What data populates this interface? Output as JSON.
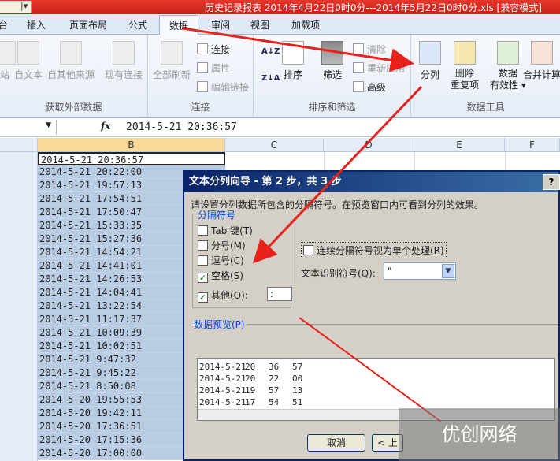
{
  "title_bar": {
    "quick_access": "|▾",
    "title": "历史记录报表 2014年4月22日0时0分---2014年5月22日0时0分.xls [兼容模式]"
  },
  "tabs": [
    "台",
    "插入",
    "页面布局",
    "公式",
    "数据",
    "审阅",
    "视图",
    "加载项"
  ],
  "active_tab": "数据",
  "ribbon": {
    "external": {
      "web": "站",
      "text": "自文本",
      "other": "自其他来源",
      "existing": "现有连接",
      "label": "获取外部数据"
    },
    "connections": {
      "refresh_all": "全部刷新",
      "connections": "连接",
      "properties": "属性",
      "edit_links": "编辑链接",
      "label": "连接"
    },
    "sort": {
      "sort": "排序",
      "filter": "筛选",
      "clear": "清除",
      "reapply": "重新应用",
      "advanced": "高级",
      "label": "排序和筛选",
      "az": "A↓Z",
      "za": "Z↓A"
    },
    "tools": {
      "text_to_columns": "分列",
      "remove_duplicates": "删除",
      "remove_duplicates_2": "重复项",
      "validation": "数据",
      "validation_2": "有效性",
      "consolidate": "合并计算",
      "label": "数据工具"
    }
  },
  "formula_bar": {
    "fx": "fx",
    "value": "2014-5-21  20:36:57"
  },
  "columns": [
    "B",
    "C",
    "D",
    "E",
    "F"
  ],
  "cells": [
    "2014-5-21 20:36:57",
    "2014-5-21 20:22:00",
    "2014-5-21 19:57:13",
    "2014-5-21 17:54:51",
    "2014-5-21 17:50:47",
    "2014-5-21 15:33:35",
    "2014-5-21 15:27:36",
    "2014-5-21 14:54:21",
    "2014-5-21 14:41:01",
    "2014-5-21 14:26:53",
    "2014-5-21 14:04:41",
    "2014-5-21 13:22:54",
    "2014-5-21 11:17:37",
    "2014-5-21 10:09:39",
    "2014-5-21 10:02:51",
    "2014-5-21 9:47:32",
    "2014-5-21 9:45:22",
    "2014-5-21 8:50:08",
    "2014-5-20 19:55:53",
    "2014-5-20 19:42:11",
    "2014-5-20 17:36:51",
    "2014-5-20 17:15:36",
    "2014-5-20 17:00:00"
  ],
  "dialog": {
    "title": "文本分列向导 - 第 2 步，共 3 步",
    "help": "?",
    "description": "请设置分列数据所包含的分隔符号。在预览窗口内可看到分列的效果。",
    "delimiters_legend": "分隔符号",
    "options": [
      {
        "label": "Tab 键(T)",
        "checked": false
      },
      {
        "label": "分号(M)",
        "checked": false
      },
      {
        "label": "逗号(C)",
        "checked": false
      },
      {
        "label": "空格(S)",
        "checked": true
      },
      {
        "label": "其他(O):",
        "checked": true
      }
    ],
    "other_value": ":",
    "consecutive": "连续分隔符号视为单个处理(R)",
    "qualifier_label": "文本识别符号(Q):",
    "qualifier_value": "\"",
    "preview_label": "数据预览(P)",
    "preview_rows": [
      [
        "2014-5-21",
        "20",
        "36",
        "57"
      ],
      [
        "2014-5-21",
        "20",
        "22",
        "00"
      ],
      [
        "2014-5-21",
        "19",
        "57",
        "13"
      ],
      [
        "2014-5-21",
        "17",
        "54",
        "51"
      ]
    ],
    "cancel": "取消",
    "back": "< 上"
  },
  "watermark": "优创网络",
  "colors": {
    "title_bar": "#d42a22",
    "dialog_title": "#0a246a",
    "selection": "#b8cce4",
    "arrow": "#e8211b"
  }
}
